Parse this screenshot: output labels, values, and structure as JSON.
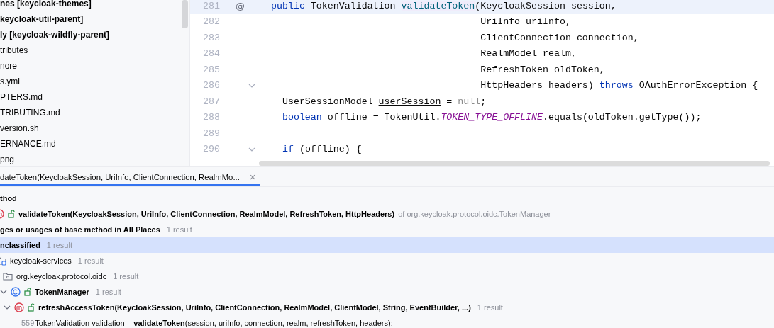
{
  "project_tree": {
    "items": [
      {
        "label": "nes [keycloak-themes]",
        "kind": "module"
      },
      {
        "label": "keycloak-util-parent]",
        "kind": "module"
      },
      {
        "label": "ly [keycloak-wildfly-parent]",
        "kind": "module"
      },
      {
        "label": "tributes",
        "kind": "file"
      },
      {
        "label": "nore",
        "kind": "file"
      },
      {
        "label": "s.yml",
        "kind": "file"
      },
      {
        "label": "PTERS.md",
        "kind": "file"
      },
      {
        "label": "TRIBUTING.md",
        "kind": "file"
      },
      {
        "label": "version.sh",
        "kind": "file"
      },
      {
        "label": "ERNANCE.md",
        "kind": "file"
      },
      {
        "label": "png",
        "kind": "file"
      }
    ]
  },
  "editor": {
    "lines": [
      {
        "number": "281",
        "kind": "declaration",
        "current": true,
        "gutter_icon": "@",
        "fold": false,
        "segments": [
          {
            "kind": "keyword",
            "text": "public"
          },
          {
            "kind": "plain",
            "text": " TokenValidation "
          },
          {
            "kind": "declaration",
            "text": "validateToken"
          },
          {
            "kind": "plain",
            "text": "(KeycloakSession session,"
          }
        ]
      },
      {
        "number": "282",
        "kind": "continuation",
        "current": false,
        "fold": false,
        "segments": [
          {
            "kind": "plain",
            "text": "UriInfo uriInfo,"
          }
        ]
      },
      {
        "number": "283",
        "kind": "continuation",
        "current": false,
        "fold": false,
        "segments": [
          {
            "kind": "plain",
            "text": "ClientConnection connection,"
          }
        ]
      },
      {
        "number": "284",
        "kind": "continuation",
        "current": false,
        "fold": false,
        "segments": [
          {
            "kind": "plain",
            "text": "RealmModel realm,"
          }
        ]
      },
      {
        "number": "285",
        "kind": "continuation",
        "current": false,
        "fold": false,
        "segments": [
          {
            "kind": "plain",
            "text": "RefreshToken oldToken,"
          }
        ]
      },
      {
        "number": "286",
        "kind": "continuation",
        "current": false,
        "fold": true,
        "segments": [
          {
            "kind": "plain",
            "text": "HttpHeaders headers) "
          },
          {
            "kind": "keyword",
            "text": "throws"
          },
          {
            "kind": "plain",
            "text": " OAuthErrorException {"
          }
        ]
      },
      {
        "number": "287",
        "kind": "body",
        "current": false,
        "fold": false,
        "segments": [
          {
            "kind": "plain",
            "text": "UserSessionModel "
          },
          {
            "kind": "underlined",
            "text": "userSession"
          },
          {
            "kind": "plain",
            "text": " = "
          },
          {
            "kind": "null",
            "text": "null"
          },
          {
            "kind": "plain",
            "text": ";"
          }
        ]
      },
      {
        "number": "288",
        "kind": "body",
        "current": false,
        "fold": false,
        "segments": [
          {
            "kind": "keyword",
            "text": "boolean"
          },
          {
            "kind": "plain",
            "text": " offline = TokenUtil."
          },
          {
            "kind": "constant",
            "text": "TOKEN_TYPE_OFFLINE"
          },
          {
            "kind": "plain",
            "text": ".equals(oldToken.getType());"
          }
        ]
      },
      {
        "number": "289",
        "kind": "body",
        "current": false,
        "fold": false
      },
      {
        "number": "290",
        "kind": "body",
        "current": false,
        "fold": true,
        "segments": [
          {
            "kind": "keyword",
            "text": "if"
          },
          {
            "kind": "plain",
            "text": " (offline) {"
          }
        ]
      }
    ]
  },
  "find_panel": {
    "tabs": [
      {
        "label": "dateToken(KeycloakSession, UriInfo, ClientConnection, RealmMo...",
        "close": "×",
        "selected": true
      }
    ],
    "tree": [
      {
        "label": "thod",
        "kind": "group",
        "children": [
          {
            "label": "validateToken(KeycloakSession, UriInfo, ClientConnection, RealmModel, RefreshToken, HttpHeaders)",
            "detail": "of org.keycloak.protocol.oidc.TokenManager",
            "kind": "method",
            "selected": false
          }
        ]
      },
      {
        "label": "ges or usages of base method in All Places",
        "count": "1 result",
        "kind": "group",
        "children": [
          {
            "label": "nclassified",
            "count": "1 result",
            "kind": "group",
            "selected": true,
            "children": [
              {
                "label": "keycloak-services",
                "count": "1 result",
                "kind": "module",
                "selected": false,
                "children": [
                  {
                    "label": "org.keycloak.protocol.oidc",
                    "count": "1 result",
                    "kind": "package",
                    "selected": false,
                    "children": [
                      {
                        "label": "TokenManager",
                        "count": "1 result",
                        "kind": "class",
                        "expanded": true,
                        "selected": false,
                        "children": [
                          {
                            "label": "refreshAccessToken(KeycloakSession, UriInfo, ClientConnection, RealmModel, ClientModel, String, EventBuilder, ...)",
                            "count": "1 result",
                            "kind": "method",
                            "expanded": true,
                            "selected": false,
                            "children": [
                              {
                                "kind": "usage",
                                "line": "559",
                                "text": "TokenValidation validation = **validateToken**(session, uriInfo, connection, realm, refreshToken, headers);",
                                "selected": false
                              }
                            ]
                          }
                        ]
                      }
                    ]
                  }
                ]
              }
            ]
          }
        ]
      }
    ]
  }
}
